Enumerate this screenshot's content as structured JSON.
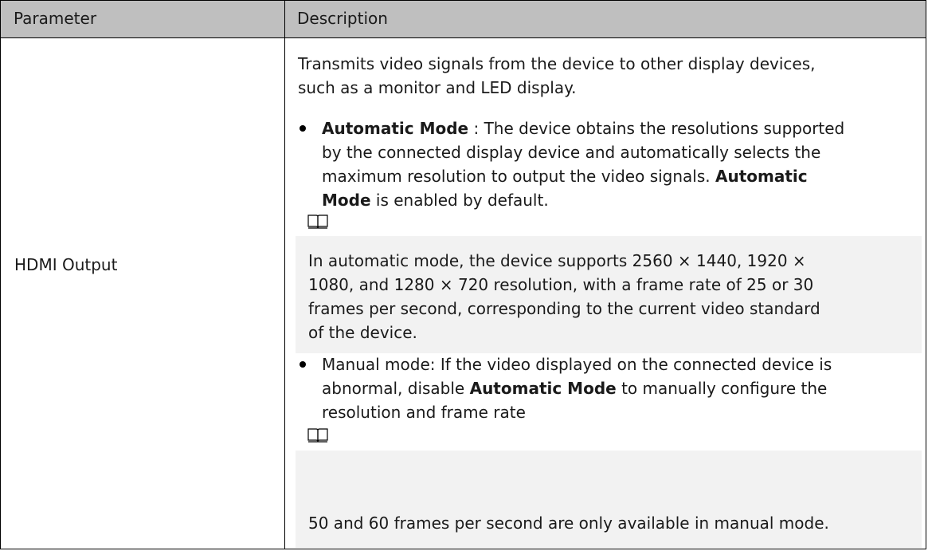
{
  "header": {
    "parameter": "Parameter",
    "description": "Description"
  },
  "row": {
    "parameter": "HDMI Output",
    "intro": [
      "Transmits video signals from the device to other display devices,",
      "such as a monitor and LED display."
    ],
    "bullet1": {
      "term1": "Automatic Mode",
      "l1_rest": " : The device obtains the resolutions supported",
      "l2": "by the connected display device and automatically selects the",
      "l3_start": "maximum resolution to output the video signals. ",
      "term2a": "Automatic",
      "term2b": "Mode",
      "l4_rest": " is enabled by default."
    },
    "note1": [
      "In automatic mode, the device supports 2560 × 1440, 1920 ×",
      "1080, and 1280 × 720 resolution, with a frame rate of 25 or 30",
      "frames per second, corresponding to the current video standard",
      "of the device."
    ],
    "bullet2": {
      "l1": "Manual mode: If the video displayed on the connected device is",
      "l2_start": "abnormal, disable ",
      "term": "Automatic Mode",
      "l2_rest": "  to manually configure the",
      "l3": "resolution and frame rate"
    },
    "note2": "50 and 60 frames per second are only available in manual mode."
  },
  "icons": {
    "note_icon": "open-book-icon"
  }
}
